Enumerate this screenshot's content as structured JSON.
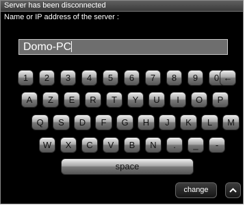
{
  "dialog": {
    "title": "Server has been disconnected",
    "field_label": "Name or IP address of the server :",
    "server_value": "Domo-PC"
  },
  "keyboard": {
    "row1": [
      "1",
      "2",
      "3",
      "4",
      "5",
      "6",
      "7",
      "8",
      "9",
      "0"
    ],
    "backspace_icon": "left-arrow",
    "backspace_glyph": "←",
    "row2": [
      "A",
      "Z",
      "E",
      "R",
      "T",
      "Y",
      "U",
      "I",
      "O",
      "P"
    ],
    "row3": [
      "Q",
      "S",
      "D",
      "F",
      "G",
      "H",
      "J",
      "K",
      "L",
      "M"
    ],
    "row4": [
      "W",
      "X",
      "C",
      "V",
      "B",
      "N",
      ".",
      "_",
      "-"
    ],
    "space_label": "space"
  },
  "footer": {
    "change_label": "change",
    "up_icon": "chevron-up"
  }
}
